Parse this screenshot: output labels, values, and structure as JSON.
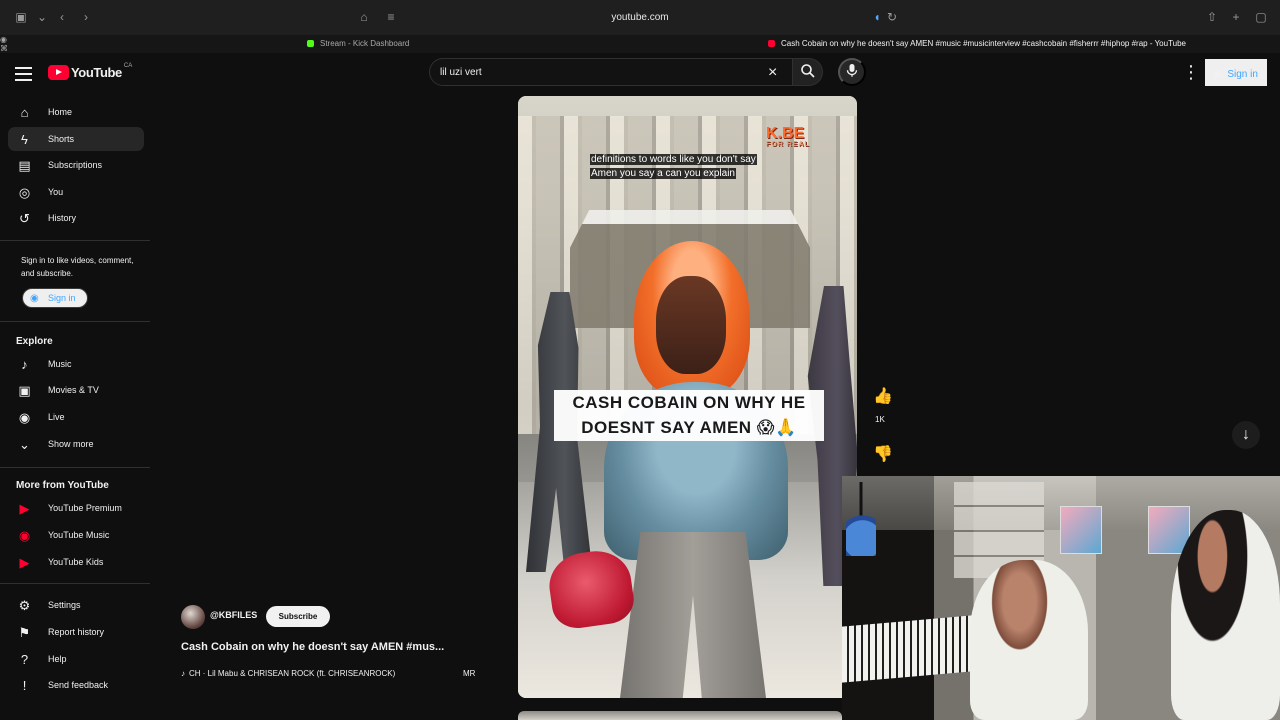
{
  "browser": {
    "url": "youtube.com",
    "tabs": [
      {
        "label": "Stream - Kick Dashboard",
        "active": false,
        "color": "#53fc18"
      },
      {
        "label": "Cash Cobain on why he doesn't say AMEN #music #musicinterview #cashcobain #fisherrr #hiphop #rap - YouTube",
        "active": true,
        "color": "#ff0033"
      }
    ]
  },
  "header": {
    "brand": "YouTube",
    "region": "CA",
    "search_value": "lil uzi vert",
    "signin": "Sign in"
  },
  "sidebar": {
    "primary": [
      {
        "label": "Home",
        "icon": "home-icon",
        "active": false
      },
      {
        "label": "Shorts",
        "icon": "shorts-icon",
        "active": true
      },
      {
        "label": "Subscriptions",
        "icon": "subscriptions-icon",
        "active": false
      },
      {
        "label": "You",
        "icon": "you-icon",
        "active": false
      },
      {
        "label": "History",
        "icon": "history-icon",
        "active": false
      }
    ],
    "signin_prompt": "Sign in to like videos, comment, and subscribe.",
    "signin_button": "Sign in",
    "explore_title": "Explore",
    "explore": [
      {
        "label": "Music",
        "icon": "music-icon"
      },
      {
        "label": "Movies & TV",
        "icon": "movies-tv-icon"
      },
      {
        "label": "Live",
        "icon": "live-icon"
      },
      {
        "label": "Show more",
        "icon": "chevron-down-icon"
      }
    ],
    "more_title": "More from YouTube",
    "more": [
      {
        "label": "YouTube Premium",
        "icon": "youtube-premium-icon"
      },
      {
        "label": "YouTube Music",
        "icon": "youtube-music-icon"
      },
      {
        "label": "YouTube Kids",
        "icon": "youtube-kids-icon"
      }
    ],
    "footer": [
      {
        "label": "Settings",
        "icon": "gear-icon"
      },
      {
        "label": "Report history",
        "icon": "flag-icon"
      },
      {
        "label": "Help",
        "icon": "help-icon"
      },
      {
        "label": "Send feedback",
        "icon": "feedback-icon"
      }
    ]
  },
  "video": {
    "caption_line1": "definitions to words like you don't say",
    "caption_line2": "Amen you say a can you explain",
    "watermark_main": "K.BE",
    "watermark_sub": "FOR REAL",
    "title_card_line1": "CASH COBAIN ON WHY HE",
    "title_card_line2": "DOESNT SAY AMEN 😱🙏",
    "likes": "1K"
  },
  "meta": {
    "channel": "@KBFILES",
    "subscribe": "Subscribe",
    "title": "Cash Cobain on why he doesn't say AMEN #mus...",
    "music": "CH · Lil Mabu & CHRISEAN ROCK (ft. CHRISEANROCK)",
    "music_suffix": "MR"
  },
  "colors": {
    "background": "#0f0f0f",
    "active_nav": "#272727",
    "link_blue": "#3ea6ff",
    "youtube_red": "#ff0033"
  }
}
